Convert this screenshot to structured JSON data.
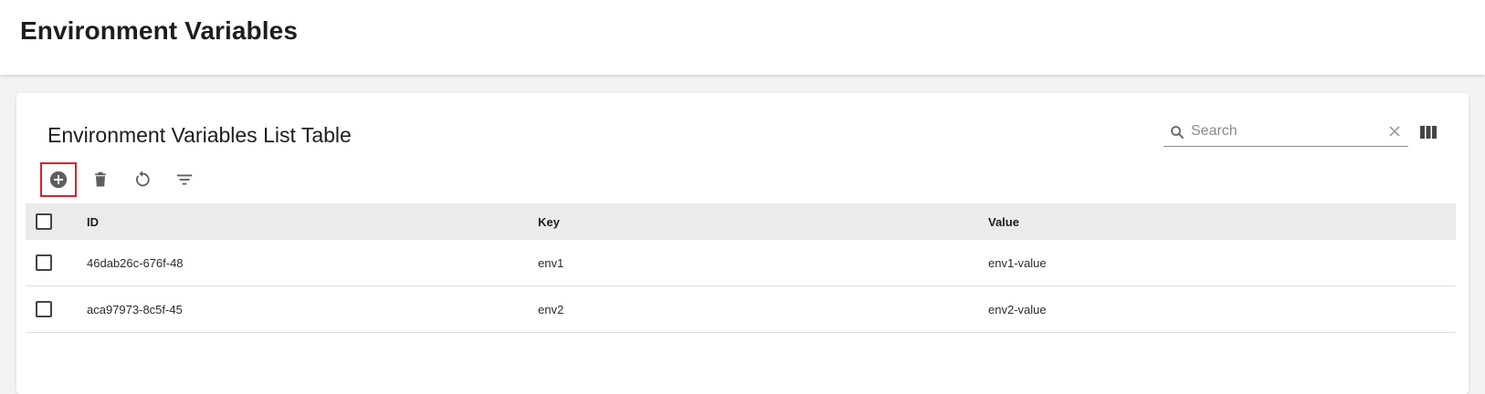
{
  "header": {
    "title": "Environment Variables"
  },
  "table": {
    "title": "Environment Variables List Table",
    "search": {
      "placeholder": "Search",
      "value": ""
    },
    "toolbar": {
      "buttons": [
        {
          "icon": "add-circle-icon"
        },
        {
          "icon": "delete-icon"
        },
        {
          "icon": "refresh-icon"
        },
        {
          "icon": "filter-icon"
        }
      ]
    },
    "columns": [
      "ID",
      "Key",
      "Value"
    ],
    "rows": [
      {
        "id": "46dab26c-676f-48",
        "key": "env1",
        "value": "env1-value"
      },
      {
        "id": "aca97973-8c5f-45",
        "key": "env2",
        "value": "env2-value"
      }
    ]
  },
  "colors": {
    "highlight": "#d9202e",
    "header_row": "#ebebeb",
    "icon": "#5f5f5f"
  }
}
